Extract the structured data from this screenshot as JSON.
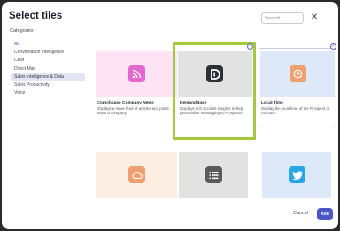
{
  "dialog": {
    "title": "Select tiles",
    "search_placeholder": "Search",
    "close_glyph": "✕",
    "categories_heading": "Categories"
  },
  "categories": [
    {
      "label": "All"
    },
    {
      "label": "Conversation Intelligence"
    },
    {
      "label": "CRM"
    },
    {
      "label": "Direct Mail"
    },
    {
      "label": "Sales Intelligence & Data"
    },
    {
      "label": "Sales Productivity"
    },
    {
      "label": "Voice"
    }
  ],
  "active_category": "Sales Intelligence & Data",
  "tiles": [
    {
      "name": "Crunchbase Company News",
      "description": "Displays a news feed of articles and posts about a company.",
      "icon": "rss-icon",
      "banner_color": "#fde3f3",
      "icon_color": "#e368cf",
      "selected": false
    },
    {
      "name": "DemandBase",
      "description": "Displays rich account insights to help personalize messaging to Prospects",
      "icon": "demandbase-logo-icon",
      "banner_color": "#e2e2e2",
      "icon_color": "#2f3037",
      "selected": true
    },
    {
      "name": "Local Time",
      "description": "Display the local time of the Prospect or Account.",
      "icon": "clock-icon",
      "banner_color": "#dde9f8",
      "icon_color": "#f0a070",
      "selected": true
    },
    {
      "name": "",
      "description": "",
      "icon": "cloud-icon",
      "banner_color": "#fdeee4",
      "icon_color": "#f0a070",
      "selected": false
    },
    {
      "name": "",
      "description": "",
      "icon": "list-icon",
      "banner_color": "#e2e2e2",
      "icon_color": "#5a5a5a",
      "selected": false
    },
    {
      "name": "",
      "description": "",
      "icon": "twitter-icon",
      "banner_color": "#dde9f8",
      "icon_color": "#28a7e6",
      "selected": false
    }
  ],
  "footer": {
    "cancel_label": "Cancel",
    "add_label": "Add"
  },
  "colors": {
    "accent": "#4a55c7",
    "highlight_frame": "#a3c93a",
    "active_category_bg": "#e4e5f2"
  }
}
